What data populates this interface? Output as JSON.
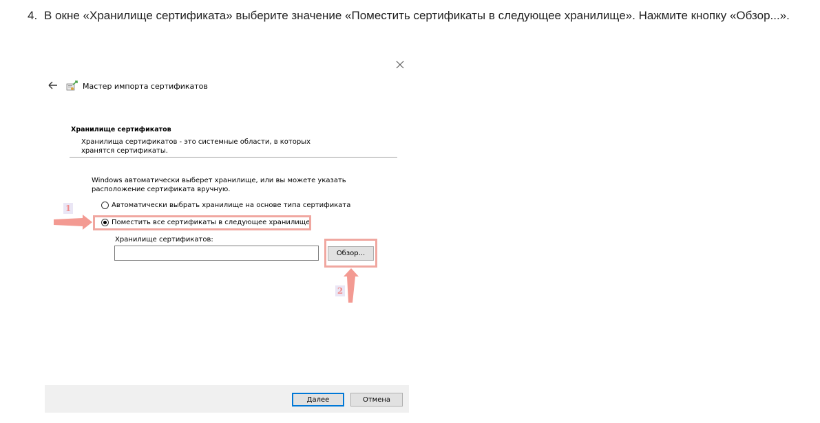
{
  "step": {
    "number": "4.",
    "text": "В окне «Хранилище сертификата» выберите значение «Поместить сертификаты в следующее хранилище». Нажмите кнопку «Обзор...»."
  },
  "dialog": {
    "title": "Мастер импорта сертификатов",
    "section_title": "Хранилище сертификатов",
    "section_desc": "Хранилища сертификатов - это системные области, в которых хранятся сертификаты.",
    "body_text": "Windows автоматически выберет хранилище, или вы можете указать расположение сертификата вручную.",
    "radio_auto": "Автоматически выбрать хранилище на основе типа сертификата",
    "radio_place": "Поместить все сертификаты в следующее хранилище",
    "selected_option": "radio_place",
    "store_label": "Хранилище сертификатов:",
    "store_value": "",
    "browse_label": "Обзор...",
    "next_label": "Далее",
    "cancel_label": "Отмена"
  },
  "annotations": {
    "badge_1": "1",
    "badge_2": "2",
    "highlight_color": "#f0a7a0",
    "arrow_color": "#f39a92",
    "badge_text_color": "#f08d8d"
  },
  "icons": [
    "close-icon",
    "back-arrow-icon",
    "certificate-wizard-icon"
  ]
}
